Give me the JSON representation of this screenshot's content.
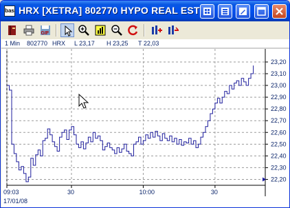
{
  "window": {
    "app_icon_label": "bas",
    "title": "HRX [XETRA]  802770  HYPO REAL EST"
  },
  "title_buttons": [
    "minimize",
    "maximize",
    "restore",
    "close"
  ],
  "toolbar": {
    "tools": [
      "book-icon",
      "print-icon",
      "save-gif-icon",
      "pointer-icon",
      "zoom-in-icon",
      "chart-type-icon",
      "zoom-out-icon",
      "refresh-icon",
      "indicator-add-icon",
      "indicator-remove-icon"
    ],
    "gif_label": "GIF"
  },
  "info_bar": {
    "interval": "1 Min",
    "wkn": "802770",
    "symbol": "HRX",
    "low": "L  23,17",
    "high": "H  23,25",
    "time": "T  22,03"
  },
  "chart_data": {
    "type": "line",
    "title": "",
    "xlabel": "",
    "ylabel": "",
    "ylim": [
      22.15,
      23.27
    ],
    "y_ticks": [
      "23,20",
      "23,10",
      "23,00",
      "22,90",
      "22,80",
      "22,70",
      "22,60",
      "22,50",
      "22,40",
      "22,30",
      "22,20"
    ],
    "y_tick_values": [
      23.2,
      23.1,
      23.0,
      22.9,
      22.8,
      22.7,
      22.6,
      22.5,
      22.4,
      22.3,
      22.2
    ],
    "x_ticks": [
      "09:03",
      "30",
      "10:00",
      "30"
    ],
    "x_tick_minutes": [
      0,
      27,
      57,
      87
    ],
    "date_label": "17/01/08",
    "last_marker_value": 22.2,
    "series": [
      {
        "minutes": [
          0,
          1,
          2,
          3,
          4,
          5,
          6,
          7,
          8,
          9,
          10,
          11,
          12,
          13,
          14,
          15,
          16,
          17,
          18,
          19,
          20,
          21,
          22,
          23,
          24,
          25,
          26,
          27,
          28,
          29,
          30,
          31,
          32,
          33,
          34,
          35,
          36,
          37,
          38,
          39,
          40,
          41,
          42,
          43,
          44,
          45,
          46,
          47,
          48,
          49,
          50,
          51,
          52,
          53,
          54,
          55,
          56,
          57,
          58,
          59,
          60,
          61,
          62,
          63,
          64,
          65,
          66,
          67,
          68,
          69,
          70,
          71,
          72,
          73,
          74,
          75,
          76,
          77,
          78,
          79,
          80,
          81,
          82,
          83,
          84,
          85,
          86,
          87,
          88,
          89,
          90,
          91,
          92,
          93,
          94,
          95,
          96,
          97,
          98,
          99,
          100,
          101,
          102,
          103
        ],
        "values": [
          23.0,
          22.96,
          22.5,
          22.42,
          22.35,
          22.28,
          22.31,
          22.25,
          22.18,
          22.22,
          22.38,
          22.32,
          22.41,
          22.45,
          22.4,
          22.53,
          22.55,
          22.63,
          22.58,
          22.52,
          22.48,
          22.44,
          22.56,
          22.6,
          22.62,
          22.54,
          22.62,
          22.65,
          22.58,
          22.5,
          22.47,
          22.52,
          22.46,
          22.51,
          22.56,
          22.52,
          22.6,
          22.55,
          22.57,
          22.53,
          22.45,
          22.48,
          22.51,
          22.47,
          22.45,
          22.42,
          22.47,
          22.43,
          22.46,
          22.5,
          22.44,
          22.42,
          22.4,
          22.5,
          22.52,
          22.56,
          22.5,
          22.53,
          22.58,
          22.55,
          22.6,
          22.56,
          22.61,
          22.57,
          22.53,
          22.59,
          22.55,
          22.53,
          22.57,
          22.52,
          22.55,
          22.5,
          22.54,
          22.49,
          22.52,
          22.51,
          22.55,
          22.5,
          22.53,
          22.47,
          22.5,
          22.56,
          22.6,
          22.65,
          22.7,
          22.76,
          22.8,
          22.85,
          22.89,
          22.85,
          22.9,
          22.95,
          22.93,
          23.0,
          22.97,
          23.02,
          23.04,
          23.0,
          23.06,
          23.03,
          23.0,
          23.06,
          23.1,
          23.17
        ]
      }
    ]
  }
}
